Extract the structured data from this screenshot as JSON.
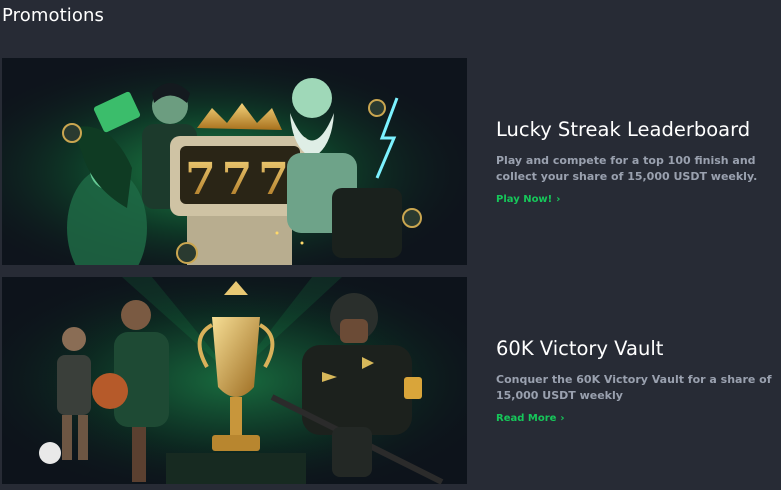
{
  "page": {
    "title": "Promotions"
  },
  "promotions": [
    {
      "title": "Lucky Streak Leaderboard",
      "description": "Play and compete for a top 100 finish and collect your share of 15,000 USDT weekly.",
      "cta": "Play Now!",
      "cta_icon": "chevron-right-icon",
      "banner_digits": "777"
    },
    {
      "title": "60K Victory Vault",
      "description": "Conquer the 60K Victory Vault for a share of 15,000 USDT weekly",
      "cta": "Read More",
      "cta_icon": "chevron-right-icon"
    }
  ],
  "colors": {
    "background": "#272b35",
    "accent_green": "#16c75a",
    "muted_text": "#9aa1af",
    "banner_bg": "#101520",
    "gold": "#d9a53a"
  }
}
